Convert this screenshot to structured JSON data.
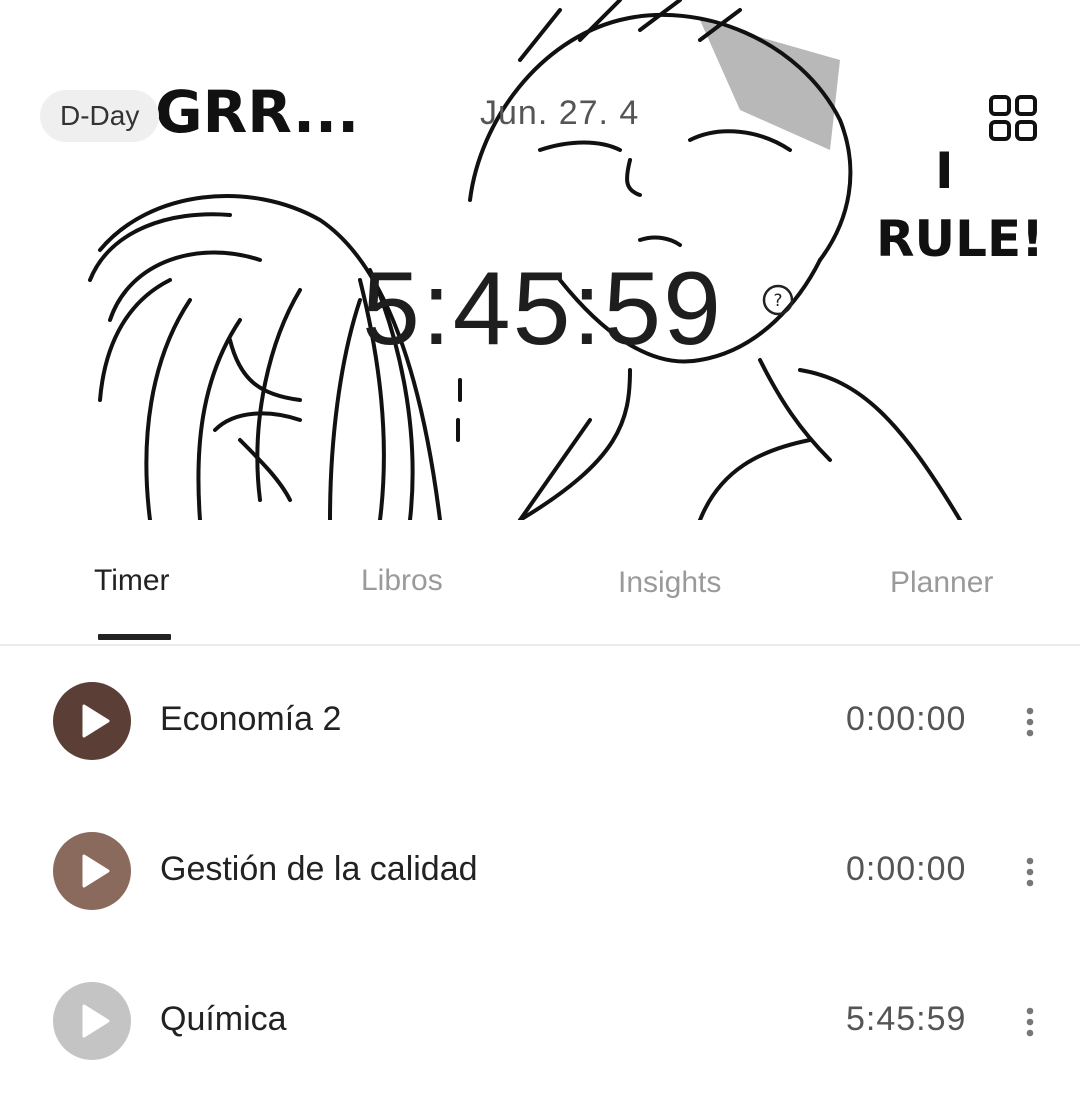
{
  "header": {
    "dday_label": "D-Day",
    "date": "Jun. 27. 4",
    "timer": "5:45:59",
    "grid_icon": "grid-icon",
    "help_icon": "question-icon",
    "art_text_left": "GRR...",
    "art_text_right_1": "I",
    "art_text_right_2": "RULE!"
  },
  "tabs": [
    {
      "label": "Timer",
      "active": true
    },
    {
      "label": "Libros",
      "active": false
    },
    {
      "label": "Insights",
      "active": false
    },
    {
      "label": "Planner",
      "active": false
    }
  ],
  "subjects": [
    {
      "name": "Economía 2",
      "time": "0:00:00",
      "color": "#5b3f36"
    },
    {
      "name": "Gestión de la calidad",
      "time": "0:00:00",
      "color": "#8b6a5e"
    },
    {
      "name": "Química",
      "time": "5:45:59",
      "color": "#c4c4c4"
    }
  ]
}
